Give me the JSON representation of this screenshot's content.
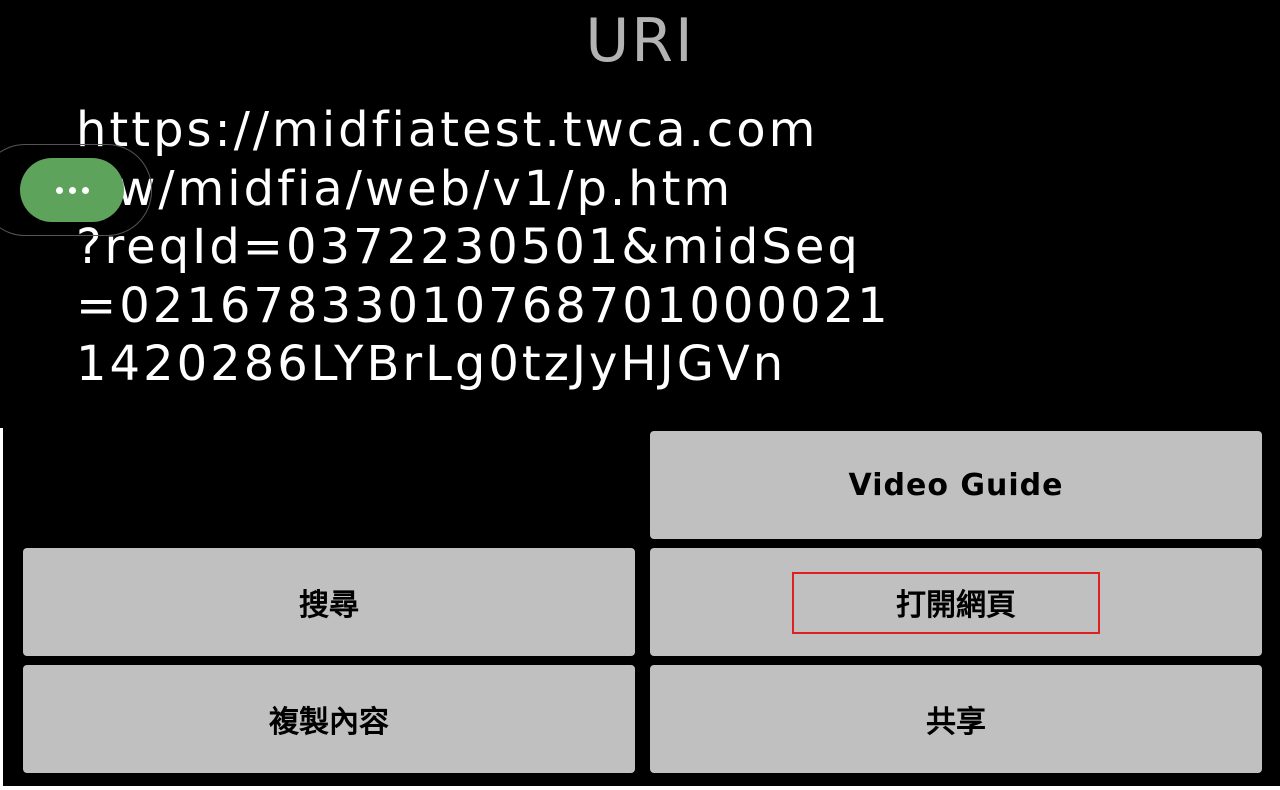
{
  "dialog": {
    "title": "URI",
    "uri_lines": [
      "https://midfiatest.twca.com",
      ".tw/midfia/web/v1/p.htm",
      "?reqId=0372230501&midSeq",
      "=02167833010768701000021",
      "1420286LYBrLg0tzJyHJGVn"
    ]
  },
  "buttons": {
    "video_guide": "Video Guide",
    "search": "搜尋",
    "open_web": "打開網頁",
    "copy_content": "複製內容",
    "share": "共享"
  },
  "floating_menu": {
    "icon": "more-horizontal-icon",
    "color": "#5ea35c"
  },
  "colors": {
    "background": "#000000",
    "title": "#b3b3b3",
    "button": "#c0c0c0",
    "highlight": "#e02020"
  }
}
